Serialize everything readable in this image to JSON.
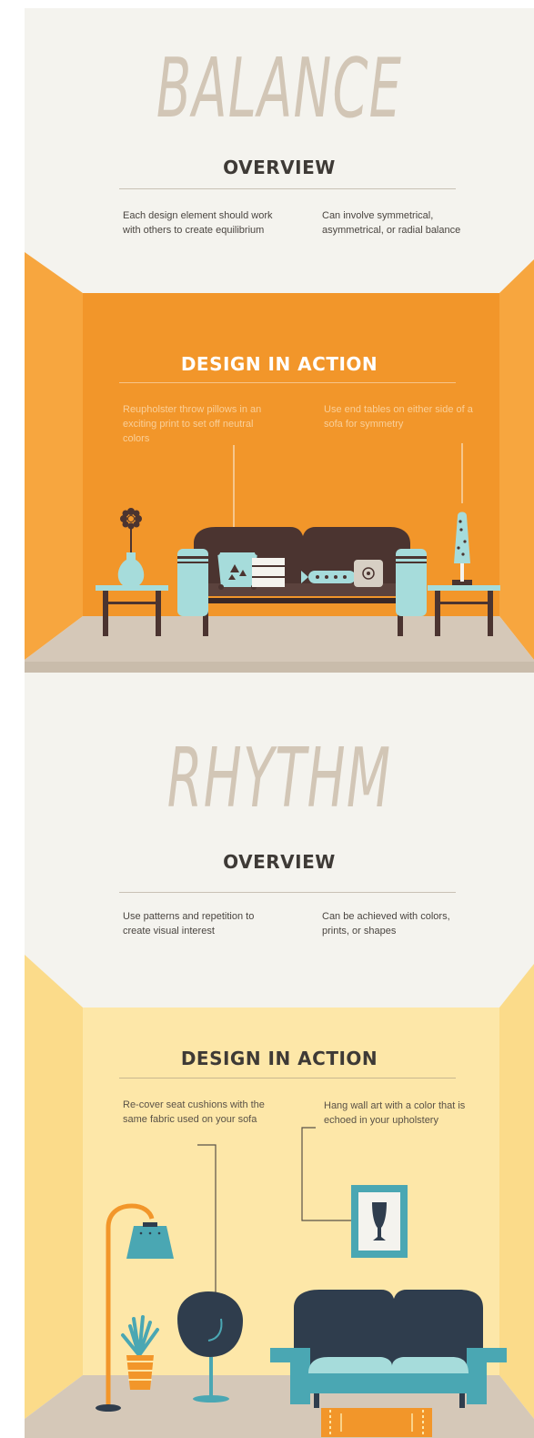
{
  "balance": {
    "title": "BALANCE",
    "overview_heading": "OVERVIEW",
    "overview_left": "Each design element should work with others to create equilibrium",
    "overview_right": "Can involve symmetrical, asymmetrical, or radial balance",
    "action_heading": "DESIGN IN ACTION",
    "callout_left": "Reupholster throw pillows in an exciting print to set off neutral colors",
    "callout_right": "Use end tables on either side of a sofa for symmetry"
  },
  "rhythm": {
    "title": "RHYTHM",
    "overview_heading": "OVERVIEW",
    "overview_left": "Use patterns and repetition to create visual interest",
    "overview_right": "Can be achieved with colors, prints, or shapes",
    "action_heading": "DESIGN IN ACTION",
    "callout_left": "Re-cover seat cushions with the same fabric used on your sofa",
    "callout_right": "Hang wall art with a color that is echoed in your upholstery"
  },
  "colors": {
    "balance_wall": "#f2962a",
    "balance_side_wall": "#f7a63f",
    "rhythm_wall": "#fde7a8",
    "rhythm_side_wall": "#fbdb8a",
    "floor": "#d5c8b8",
    "sofa_brown": "#4b3430",
    "sofa_navy": "#2f3d4d",
    "aqua": "#a6dcdb",
    "teal": "#4aa7b3"
  }
}
